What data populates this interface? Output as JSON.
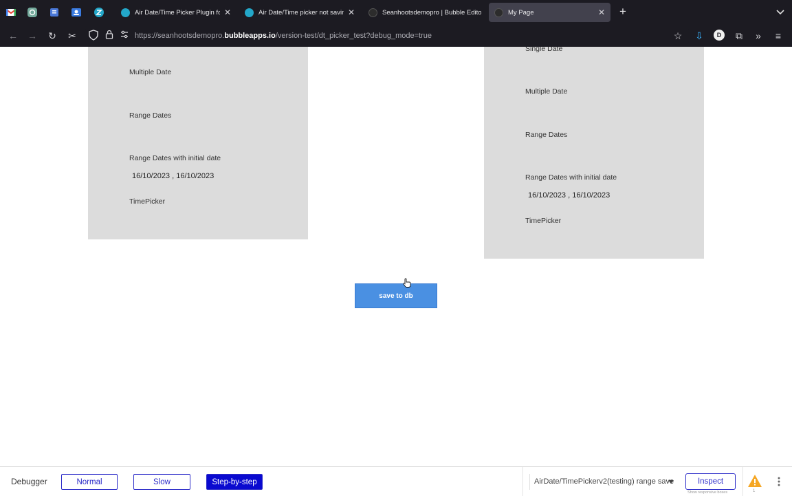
{
  "browser": {
    "tabs": [
      {
        "title": "Air Date/Time Picker Plugin for Bubble",
        "favicon_color": "#23a7c9"
      },
      {
        "title": "Air Date/Time picker not saving",
        "favicon_color": "#23a7c9"
      },
      {
        "title": "Seanhootsdemopro | Bubble Editor",
        "favicon_color": "#2c2c2c"
      },
      {
        "title": "My Page",
        "favicon_color": "#2c2c2c"
      }
    ],
    "new_tab_label": "+",
    "url_prefix": "https://seanhootsdemopro.",
    "url_domain": "bubbleapps.io",
    "url_path": "/version-test/dt_picker_test?debug_mode=true",
    "profile_initial": "D"
  },
  "left_panel": {
    "multiple_date_label": "Multiple Date",
    "range_dates_label": "Range Dates",
    "range_initial_label": "Range Dates with initial date",
    "range_initial_value": "16/10/2023 , 16/10/2023",
    "timepicker_label": "TimePicker"
  },
  "right_panel": {
    "single_date_label": "Single Date",
    "multiple_date_label": "Multiple Date",
    "range_dates_label": "Range Dates",
    "range_initial_label": "Range Dates with initial date",
    "range_initial_value": "16/10/2023 , 16/10/2023",
    "timepicker_label": "TimePicker"
  },
  "save_button_label": "save to db",
  "debugger": {
    "title": "Debugger",
    "normal_label": "Normal",
    "slow_label": "Slow",
    "step_label": "Step-by-step",
    "selected_mode": "Step-by-step",
    "workflow_select": "AirDate/TimePickerv2(testing) range save",
    "inspect_label": "Inspect",
    "inspect_sub": "Show responsive boxes",
    "warning_count": "1"
  },
  "colors": {
    "browser_bg": "#1c1b22",
    "active_tab": "#42414d",
    "panel": "#dcdcdc",
    "button": "#4a90e2",
    "debug_accent": "#2a2ac8",
    "warning": "#f5a623"
  }
}
